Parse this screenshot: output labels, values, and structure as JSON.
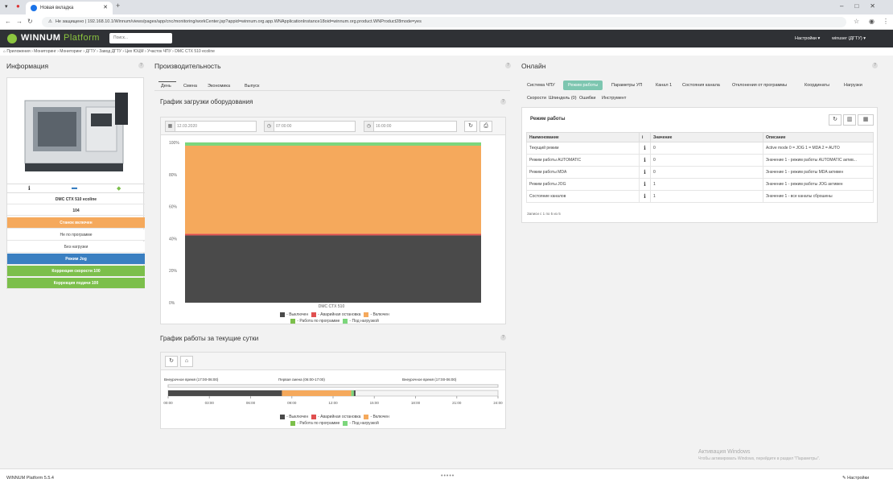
{
  "browser": {
    "tab_title": "Новая вкладка",
    "address_warning": "Не защищено",
    "url": "192.168.10.1/Winnum/views/pages/app/cnc/monitoring/workCenter.jsp?appid=winnum.org.app.WNApplicationInstance18oid=winnum.org.product.WNProduct28mode=yes"
  },
  "app": {
    "logo_word1": "WINNUM",
    "logo_word2": "Platform",
    "search_placeholder": "Поиск...",
    "settings_menu": "Настройки ▾",
    "user_menu": "winuser (ДГТУ) ▾",
    "breadcrumb": "Приложения  ›  Мониторинг  ›  Мониторинг  ›  ДГТУ  ›  Завод ДГТУ  ›  Цех ЮЦМ  ›  Участок ЧПУ  ›  DMC CTX 510 ecoline"
  },
  "info": {
    "title": "Информация",
    "machine_name": "DMC CTX 510 ecoline",
    "machine_id": "104",
    "statuses": [
      {
        "label": "Станок включен",
        "color": "#f5a95c"
      },
      {
        "label": "Не по программе",
        "color": "#ffffff"
      },
      {
        "label": "Без нагрузки",
        "color": "#ffffff"
      },
      {
        "label": "Режим Jog",
        "color": "#3a7fc1"
      },
      {
        "label": "Коррекция скорости 100",
        "color": "#7cbf4b"
      },
      {
        "label": "Коррекция подачи 100",
        "color": "#7cbf4b"
      }
    ]
  },
  "productivity": {
    "title": "Производительность",
    "tabs": [
      "День",
      "Смена",
      "Экономика",
      "Выпуск"
    ],
    "load_chart_title": "График загрузки оборудования",
    "date": "12.03.2020",
    "time_from": "07:00:00",
    "time_to": "16:00:00",
    "daily_chart_title": "График работы за текущие сутки",
    "timeline_labels": [
      "Внеурочное время (17:00-06:00)",
      "Первая смена (06:00-17:00)",
      "Внеурочное время (17:00-06:00)"
    ],
    "timeline_ticks": [
      "00:00",
      "03:00",
      "06:00",
      "09:00",
      "12:00",
      "15:00",
      "18:00",
      "21:00",
      "24:00"
    ]
  },
  "chart_data": {
    "type": "bar",
    "categories": [
      "DMC CTX 510"
    ],
    "stacked": true,
    "ylim": [
      0,
      100
    ],
    "yticks": [
      "100%",
      "80%",
      "60%",
      "40%",
      "20%",
      "0%"
    ],
    "series": [
      {
        "name": "Выключен",
        "color": "#4a4a4a",
        "values": [
          42
        ]
      },
      {
        "name": "Аварийная остановка",
        "color": "#e05050",
        "values": [
          1
        ]
      },
      {
        "name": "Включен",
        "color": "#f5a95c",
        "values": [
          55
        ]
      },
      {
        "name": "Работа по программе",
        "color": "#7cbf4b",
        "values": [
          0
        ]
      },
      {
        "name": "Под нагрузкой",
        "color": "#7cd67c",
        "values": [
          2
        ]
      }
    ]
  },
  "timeline_segments": [
    {
      "status": "Выключен",
      "from": 0,
      "to": 34.5,
      "color": "#4a4a4a"
    },
    {
      "status": "Включен",
      "from": 34.5,
      "to": 55.5,
      "color": "#f5a95c"
    },
    {
      "status": "Под нагрузкой",
      "from": 55.5,
      "to": 56.3,
      "color": "#7cd67c"
    },
    {
      "status": "Выключен",
      "from": 56.3,
      "to": 56.8,
      "color": "#4a4a4a"
    }
  ],
  "online": {
    "title": "Онлайн",
    "tabs_row1": [
      "Система ЧПУ",
      "Режим работы",
      "Параметры УП",
      "Канал 1",
      "Состояния канала",
      "Отклонения от программы",
      "Координаты",
      "Нагрузки"
    ],
    "tabs_row2": [
      "Скорости",
      "Шпиндель (0)",
      "Ошибки",
      "Инструмент"
    ],
    "active_tab": "Режим работы",
    "table_title": "Режим работы",
    "columns": [
      "Наименование",
      "i",
      "Значение",
      "Описание"
    ],
    "rows": [
      {
        "name": "Текущий режим",
        "value": "0",
        "desc": "Active mode 0 = JOG 1 = MDA 2 = AUTO"
      },
      {
        "name": "Режим работы AUTOMATIC",
        "value": "0",
        "desc": "Значение 1 - режим работы AUTOMATIC актив..."
      },
      {
        "name": "Режим работы MDA",
        "value": "0",
        "desc": "Значение 1 - режим работы MDA активен"
      },
      {
        "name": "Режим работы JOG",
        "value": "1",
        "desc": "Значение 1 - режим работы JOG активен"
      },
      {
        "name": "Состояние каналов",
        "value": "1",
        "desc": "Значение 1 - все каналы сброшены"
      }
    ],
    "records": "Записи с 1 по 5 из 5"
  },
  "footer": {
    "version": "WINNUM Platform 5.5.4",
    "settings": "Настройки"
  },
  "windows": {
    "activation": "Активация Windows",
    "activation_hint": "Чтобы активировать Windows, перейдите в раздел \"Параметры\"."
  }
}
